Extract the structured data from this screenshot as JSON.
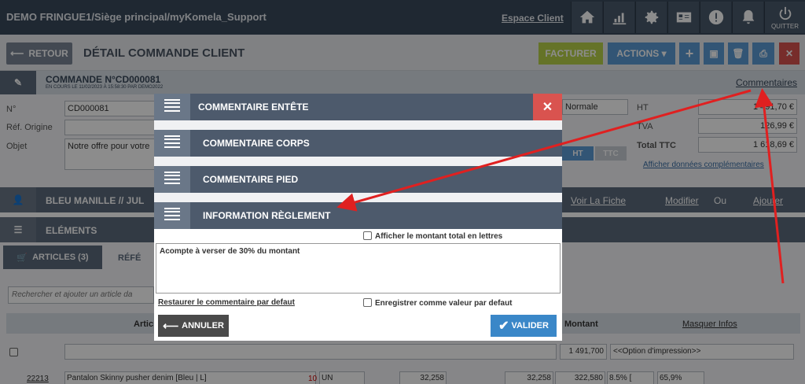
{
  "topbar": {
    "title": "DEMO FRINGUE1/Siège principal/myKomela_Support",
    "espace_client": "Espace Client",
    "quit_label": "QUITTER",
    "icons": [
      "home-icon",
      "chart-icon",
      "gear-icon",
      "id-card-icon",
      "alert-icon",
      "bell-icon",
      "power-icon"
    ]
  },
  "toolbar": {
    "back_label": "RETOUR",
    "page_title": "DÉTAIL COMMANDE CLIENT",
    "facturer_label": "FACTURER",
    "actions_label": "ACTIONS ▾"
  },
  "order": {
    "header": "COMMANDE N°CD000081",
    "sub": "EN COURS LE 11/02/2023 À 15:58:30 PAR DEMO2022",
    "comments_link": "Commentaires",
    "fields": {
      "no_label": "N°",
      "no_value": "CD000081",
      "ref_label": "Réf. Origine",
      "obj_label": "Objet",
      "obj_value": "Notre offre pour votre"
    },
    "mode_value": "Normale",
    "ht_label": "HT",
    "ht_value": "1 491,70 €",
    "tva_label": "TVA",
    "tva_value": "126,99 €",
    "ttc_label": "Total TTC",
    "ttc_value": "1 618,69 €",
    "ht_toggle": "HT",
    "ttc_toggle": "TTC",
    "more_link": "Afficher données complémentaires"
  },
  "client": {
    "name": "BLEU MANILLE // JUL",
    "view_link": "Voir La Fiche",
    "edit_link": "Modifier",
    "or_label": "Ou",
    "add_link": "Ajouter"
  },
  "elements": {
    "header": "ELÉMENTS",
    "tab_articles": "ARTICLES (3)",
    "tab_ref": "RÉFÉ",
    "search_placeholder": "Rechercher et ajouter un article da",
    "col_article": "Artic",
    "col_montant": "Montant",
    "hide_info": "Masquer Infos",
    "total_value": "1 491,700",
    "print_option": "<<Option d'impression>>",
    "row": {
      "code": "22213",
      "label": "Pantalon Skinny pusher denim [Bleu | L]",
      "qty": "10",
      "unit": "UN",
      "pu": "32,258",
      "pu2": "32,258",
      "total": "322,580",
      "tva": "8.5% [",
      "marge": "65,9%"
    }
  },
  "modal": {
    "sections": [
      {
        "label": "COMMENTAIRE ENTÊTE"
      },
      {
        "label": "COMMENTAIRE CORPS"
      },
      {
        "label": "COMMENTAIRE PIED"
      },
      {
        "label": "INFORMATION RÈGLEMENT"
      }
    ],
    "show_total_letters": "Afficher le montant total en lettres",
    "textarea_value": "Acompte à verser de 30% du montant",
    "restore_link": "Restaurer le commentaire par defaut",
    "save_default": "Enregistrer comme valeur par defaut",
    "cancel_label": "ANNULER",
    "validate_label": "VALIDER"
  },
  "colors": {
    "facturer": "#b8d24a",
    "actions": "#5b9bd5",
    "danger": "#d9534f",
    "validate": "#3a87c8",
    "cancel": "#4a4a4a",
    "arrow": "#e02020"
  }
}
